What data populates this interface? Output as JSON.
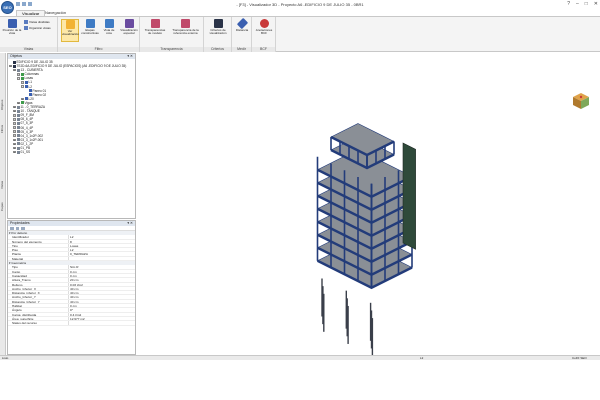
{
  "window": {
    "title": "- [F3] - Visualizador 3D - Proyecto A6 -EDIFICIO 9 DE JULIO 35 - 0BR1",
    "logo_text": "SEO",
    "controls": [
      "?",
      "–",
      "□",
      "✕"
    ]
  },
  "tabs": [
    {
      "label": "Visualizar",
      "active": true
    },
    {
      "label": "Navegación",
      "active": false
    }
  ],
  "ribbon": {
    "groups": [
      {
        "label": "Vistas",
        "buttons": [
          {
            "label": "Posición de la vista",
            "icon": "eye-icon",
            "color": "#3a5fb0"
          }
        ],
        "small": [
          {
            "label": "Vistas divididas",
            "icon": "split-view-icon"
          },
          {
            "label": "Organizar vistas",
            "icon": "arrange-icon"
          }
        ]
      },
      {
        "label": "Filtro",
        "buttons": [
          {
            "label": "Ver visualización",
            "icon": "filter-visual-icon",
            "color": "#f2b233",
            "active": true
          },
          {
            "label": "Etapas constructivas",
            "icon": "stages-icon",
            "color": "#3e7bc4"
          },
          {
            "label": "Vista de cota",
            "icon": "elevation-icon",
            "color": "#3e7bc4"
          },
          {
            "label": "Visualización especial",
            "icon": "special-view-icon",
            "color": "#6a4ca0"
          }
        ]
      },
      {
        "label": "Transparencia",
        "buttons": [
          {
            "label": "Transparencias de modelo",
            "icon": "transparency-icon",
            "color": "#c04a6a"
          },
          {
            "label": "Transparencia de la referencia externa",
            "icon": "ext-ref-icon",
            "color": "#c04a6a"
          }
        ]
      },
      {
        "label": "Criterios",
        "buttons": [
          {
            "label": "Criterios de visualización",
            "icon": "criteria-icon",
            "color": "#2a3348"
          }
        ]
      },
      {
        "label": "Medir",
        "buttons": [
          {
            "label": "Distancia",
            "icon": "ruler-icon",
            "color": "#3a5fb0"
          }
        ]
      },
      {
        "label": "BCF",
        "buttons": [
          {
            "label": "Anotaciones BCF",
            "icon": "bcf-icon",
            "color": "#c93a3a"
          }
        ]
      }
    ]
  },
  "vertical_tabs": [
    "Objetos",
    "Filtros",
    "Vistas",
    "Capas"
  ],
  "objects_panel": {
    "title": "Objetos",
    "items": [
      {
        "label": "EDIFICIO 9 DE JULIO 35",
        "level": 0,
        "icon": "dark",
        "toggle": ""
      },
      {
        "label": "TEJD-6A-EDIFICIO 9 DE JULIO (ESPACIOS) (A6 -EDIFICIO 9 DE JULIO 35)",
        "level": 0,
        "icon": "dark",
        "toggle": "-"
      },
      {
        "label": "13 - CUBIERTA",
        "level": 1,
        "icon": "gray",
        "toggle": "-"
      },
      {
        "label": "Columnas",
        "level": 2,
        "icon": "green",
        "toggle": "+"
      },
      {
        "label": "Losas",
        "level": 2,
        "icon": "green",
        "toggle": "-"
      },
      {
        "label": "L1",
        "level": 3,
        "icon": "blue",
        "toggle": "+"
      },
      {
        "label": "L2",
        "level": 3,
        "icon": "blue",
        "toggle": "-"
      },
      {
        "label": "Paneo 01",
        "level": 4,
        "icon": "blue",
        "toggle": ""
      },
      {
        "label": "Paneo 02",
        "level": 4,
        "icon": "blue",
        "toggle": ""
      },
      {
        "label": "L20",
        "level": 3,
        "icon": "blue",
        "toggle": "+"
      },
      {
        "label": "Vigas",
        "level": 2,
        "icon": "green",
        "toggle": "+"
      },
      {
        "label": "11 - 0_TERRAZA",
        "level": 1,
        "icon": "gray",
        "toggle": "+"
      },
      {
        "label": "10 - TANQUE",
        "level": 1,
        "icon": "gray",
        "toggle": "+"
      },
      {
        "label": "09_F_8M",
        "level": 1,
        "icon": "gray",
        "toggle": "+"
      },
      {
        "label": "08_6_4P",
        "level": 1,
        "icon": "gray",
        "toggle": "+"
      },
      {
        "label": "07_5_3P",
        "level": 1,
        "icon": "gray",
        "toggle": "+"
      },
      {
        "label": "06_4_4P",
        "level": 1,
        "icon": "gray",
        "toggle": "+"
      },
      {
        "label": "05_4_3P",
        "level": 1,
        "icon": "gray",
        "toggle": "+"
      },
      {
        "label": "04_3_1x2P-002",
        "level": 1,
        "icon": "gray",
        "toggle": "+"
      },
      {
        "label": "03_3_1x2P-001",
        "level": 1,
        "icon": "gray",
        "toggle": "+"
      },
      {
        "label": "02_1_2P",
        "level": 1,
        "icon": "gray",
        "toggle": "+"
      },
      {
        "label": "01_PB",
        "level": 1,
        "icon": "gray",
        "toggle": "+"
      },
      {
        "label": "01_SS",
        "level": 1,
        "icon": "gray",
        "toggle": "+"
      }
    ]
  },
  "props_panel": {
    "title": "Propiedades",
    "sections": [
      {
        "category": "Por defecto",
        "rows": [
          {
            "k": "Identificador",
            "v": "L2"
          },
          {
            "k": "Número del elemento",
            "v": "8"
          },
          {
            "k": "Tipo",
            "v": "Losas"
          },
          {
            "k": "Piso",
            "v": "L2"
          },
          {
            "k": "Planta",
            "v": "0_TERRAZA"
          },
          {
            "k": "Material",
            "v": ""
          }
        ]
      },
      {
        "category": "Geometría",
        "rows": [
          {
            "k": "Tipo",
            "v": "Sim R"
          },
          {
            "k": "Canto",
            "v": "0 cm"
          },
          {
            "k": "Capacidad",
            "v": "0 cm"
          },
          {
            "k": "Altura_Tramo",
            "v": "20 cm"
          },
          {
            "k": "Relleno",
            "v": "0.03 t/m2"
          },
          {
            "k": "Ancho_Inferior_X",
            "v": "40 cm"
          },
          {
            "k": "Distancia_inferior_X",
            "v": "40 cm"
          },
          {
            "k": "Ancho_Inferior_Y",
            "v": "40 cm"
          },
          {
            "k": "Distancia_Inferior_Y",
            "v": "40 cm"
          },
          {
            "k": "Hábitat",
            "v": "0 cm"
          },
          {
            "k": "Ángulo",
            "v": "0°"
          },
          {
            "k": "Carga_distribuida",
            "v": "0.4 t/m2"
          },
          {
            "k": "Área_superficie",
            "v": "12.977 m2"
          },
          {
            "k": "Status del recurso",
            "v": ""
          }
        ]
      }
    ]
  },
  "statusbar": {
    "left": "Listo",
    "center": "L2",
    "right": "CoFF SEO"
  },
  "colors": {
    "ribbon_bg": "#f4f4f4",
    "structure_blue": "#233c7a",
    "slab_gray": "#8a8f96",
    "column_dark": "#3a3f4a",
    "accent_orange": "#f2b233"
  }
}
